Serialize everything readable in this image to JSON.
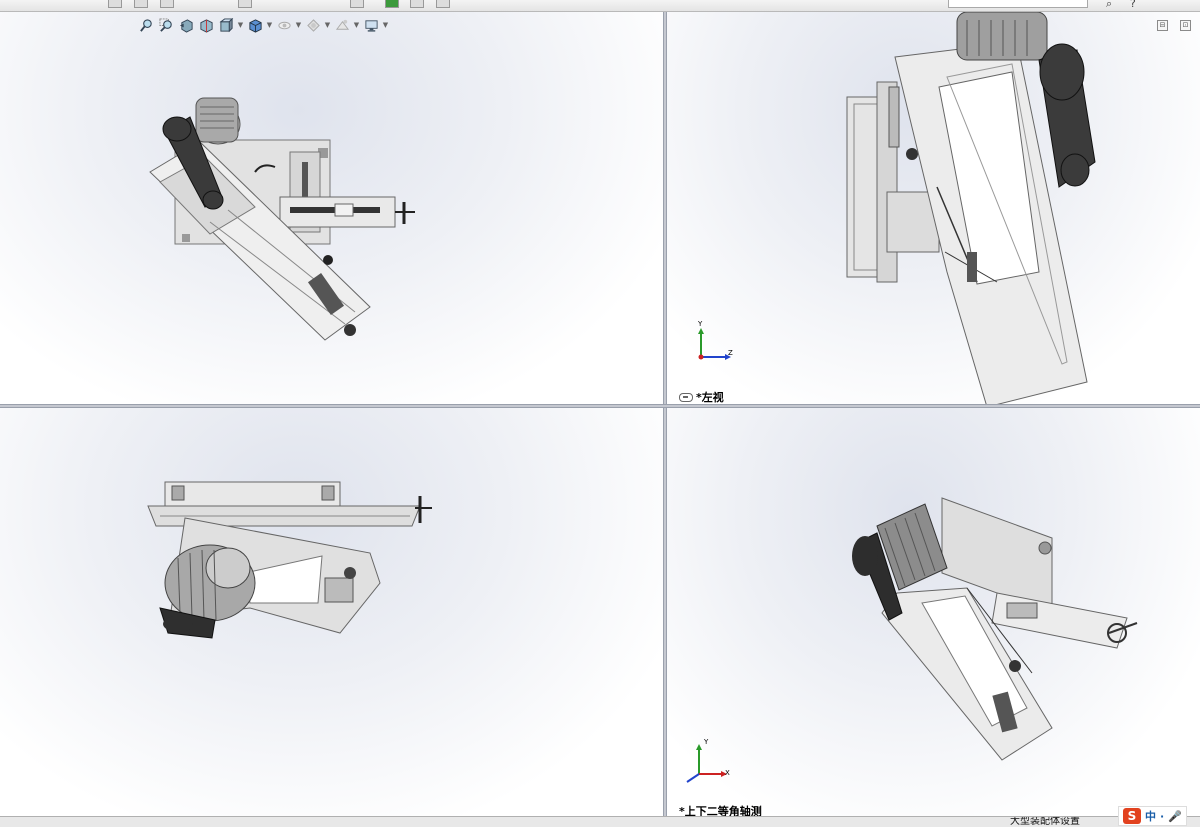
{
  "viewports": {
    "top_right": {
      "label": "*左视",
      "triad": {
        "y": "Y",
        "z": "Z"
      }
    },
    "bottom_right": {
      "label": "*上下二等角轴测",
      "triad": {
        "y": "Y",
        "x": "X"
      }
    },
    "bottom_left": {
      "label": ""
    },
    "top_left": {
      "label": ""
    }
  },
  "status_bar": {
    "text": "大型装配体设置"
  },
  "ime": {
    "logo": "S",
    "lang": "中"
  },
  "icons": [
    "zoom-to-fit-icon",
    "zoom-area-icon",
    "previous-view-icon",
    "section-view-icon",
    "view-orientation-icon",
    "display-style-icon",
    "hide-show-icon",
    "edit-appearance-icon",
    "apply-scene-icon",
    "view-settings-icon"
  ],
  "colors": {
    "viewport_top": "#dfe3ed",
    "splitter": "#c5c8d0",
    "model_light": "#e8e8e8",
    "model_dark": "#2e2e2e"
  }
}
